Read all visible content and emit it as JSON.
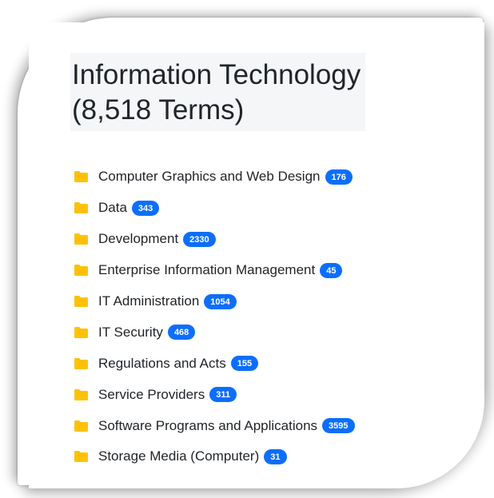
{
  "heading": {
    "line1": "Information Technology",
    "line2": "(8,518 Terms)"
  },
  "accent_colors": {
    "folder": "#ffc107",
    "badge": "#0d6efd"
  },
  "categories": [
    {
      "label": "Computer Graphics and Web Design",
      "count": "176",
      "icon": "folder-icon"
    },
    {
      "label": "Data",
      "count": "343",
      "icon": "folder-icon"
    },
    {
      "label": "Development",
      "count": "2330",
      "icon": "folder-icon"
    },
    {
      "label": "Enterprise Information Management",
      "count": "45",
      "icon": "folder-icon"
    },
    {
      "label": "IT Administration",
      "count": "1054",
      "icon": "folder-icon"
    },
    {
      "label": "IT Security",
      "count": "468",
      "icon": "folder-icon"
    },
    {
      "label": "Regulations and Acts",
      "count": "155",
      "icon": "folder-icon"
    },
    {
      "label": "Service Providers",
      "count": "311",
      "icon": "folder-icon"
    },
    {
      "label": "Software Programs and Applications",
      "count": "3595",
      "icon": "folder-icon"
    },
    {
      "label": "Storage Media (Computer)",
      "count": "31",
      "icon": "folder-icon"
    }
  ]
}
